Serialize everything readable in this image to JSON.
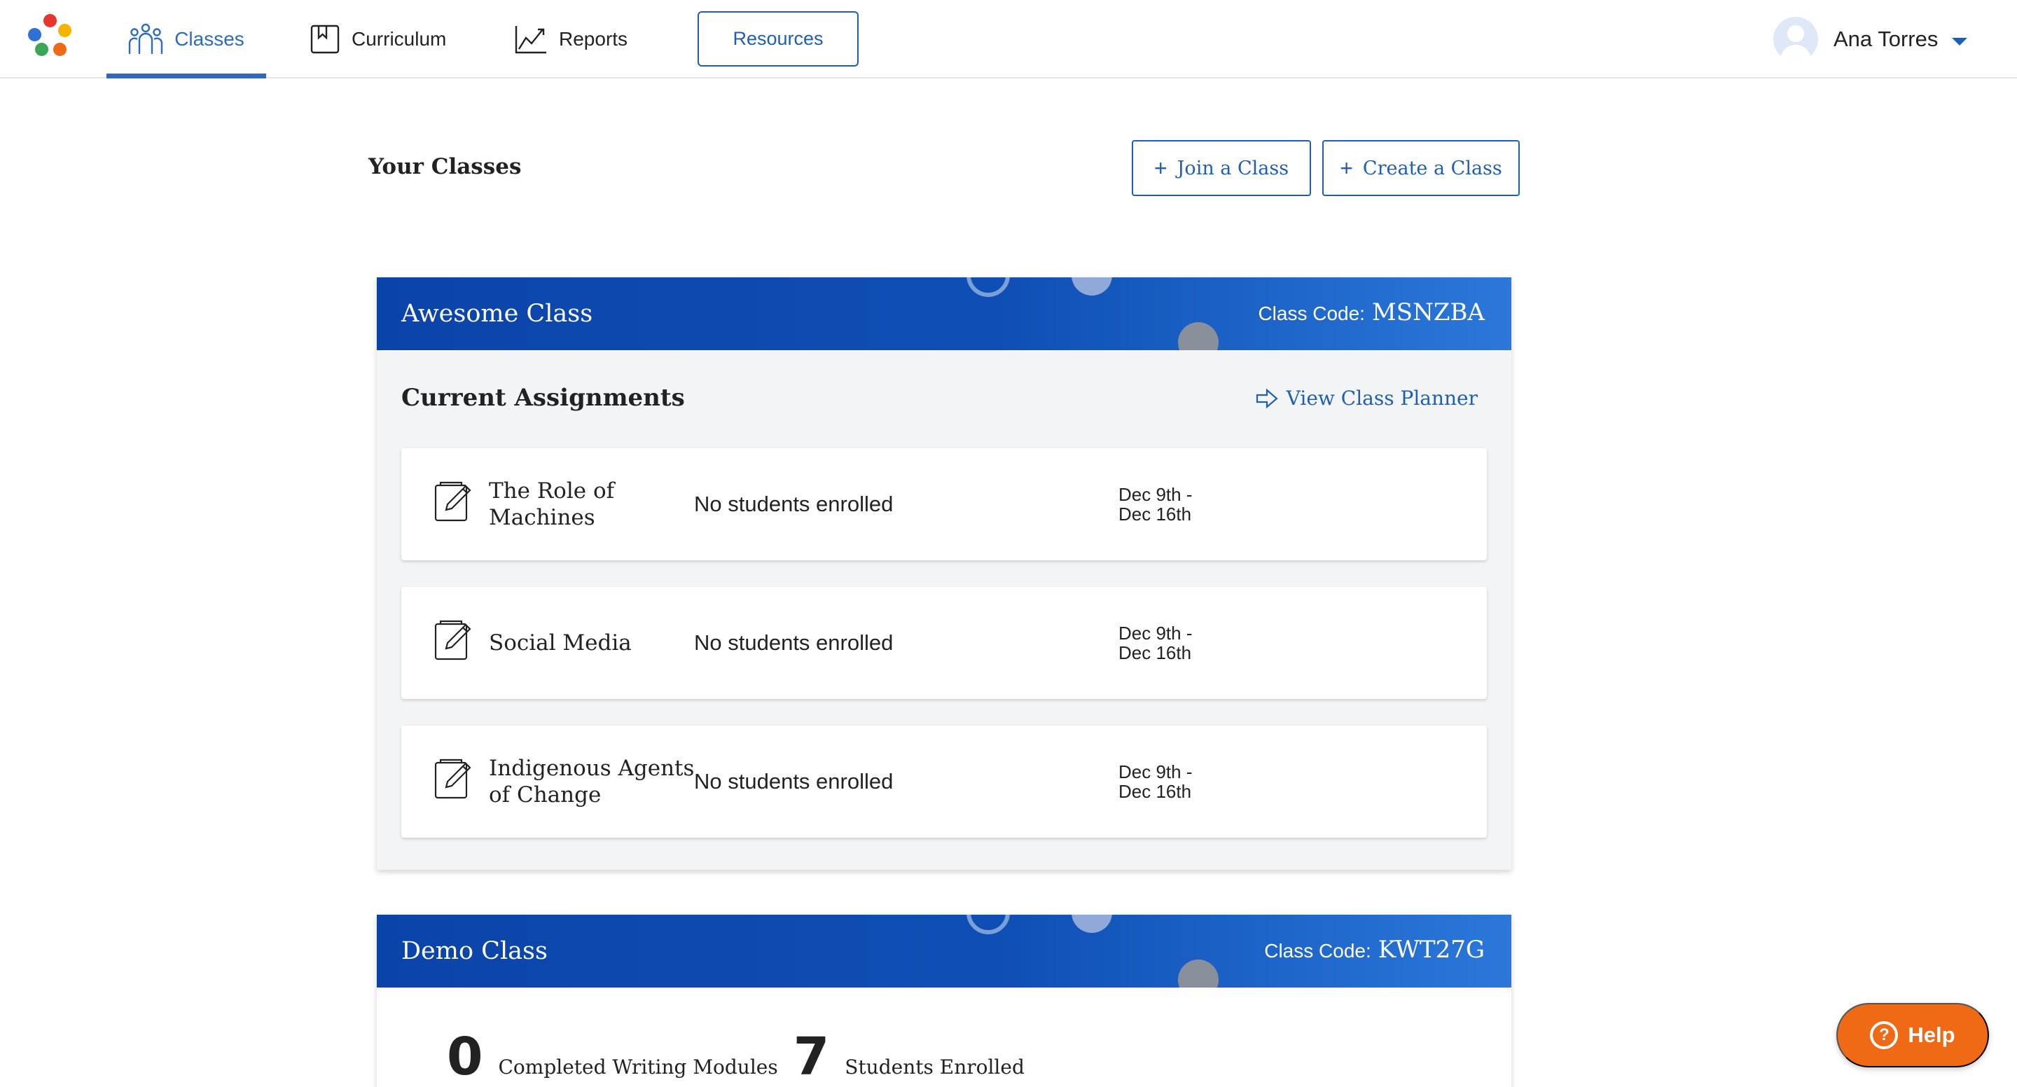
{
  "nav": {
    "classes": "Classes",
    "curriculum": "Curriculum",
    "reports": "Reports",
    "resources": "Resources"
  },
  "user": {
    "name": "Ana Torres"
  },
  "page": {
    "title": "Your Classes",
    "join_label": "Join a Class",
    "create_label": "Create a Class",
    "plus_glyph": "+"
  },
  "classes": [
    {
      "name": "Awesome Class",
      "code_label": "Class Code:",
      "code": "MSNZBA",
      "section_title": "Current Assignments",
      "planner_link": "View Class Planner",
      "assignments": [
        {
          "title": "The Role of Machines",
          "status": "No students enrolled",
          "start": "Dec 9th -",
          "end": "Dec 16th"
        },
        {
          "title": "Social Media",
          "status": "No students enrolled",
          "start": "Dec 9th -",
          "end": "Dec 16th"
        },
        {
          "title": "Indigenous Agents of Change",
          "status": "No students enrolled",
          "start": "Dec 9th -",
          "end": "Dec 16th"
        }
      ]
    },
    {
      "name": "Demo Class",
      "code_label": "Class Code:",
      "code": "KWT27G",
      "stats": [
        {
          "value": "0",
          "label": "Completed Writing Modules"
        },
        {
          "value": "7",
          "label": "Students Enrolled"
        }
      ]
    }
  ],
  "help": {
    "label": "Help",
    "glyph": "?"
  },
  "colors": {
    "primary": "#1e5fb4",
    "banner_start": "#0b44a9",
    "banner_end": "#2b78da",
    "help": "#f06a16",
    "logo": [
      "#e8352e",
      "#2f6fd6",
      "#f4b400",
      "#3aa757",
      "#f06a16"
    ]
  },
  "icons": {
    "logo": "dots-logo-icon",
    "classes": "people-icon",
    "curriculum": "bookmark-icon",
    "reports": "line-chart-icon",
    "avatar": "user-avatar-icon",
    "dropdown": "caret-down-icon",
    "planner": "arrow-right-outline-icon",
    "assignment": "edit-document-icon",
    "help": "question-circle-icon"
  }
}
